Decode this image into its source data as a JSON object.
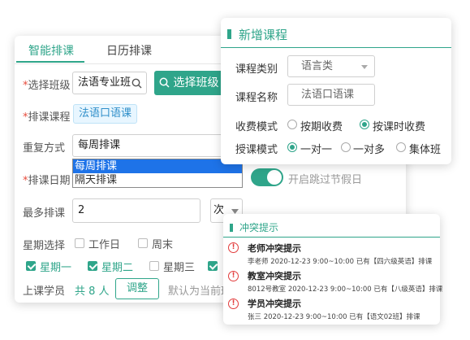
{
  "scheduler": {
    "tabs": [
      "智能排课",
      "日历排课"
    ],
    "class_select": {
      "label": "*选择班级",
      "value": "法语专业班",
      "button": "选择班级"
    },
    "course": {
      "label": "*排课课程",
      "tag": "法语口语课"
    },
    "repeat": {
      "label": "重复方式",
      "value": "每周排课",
      "options": [
        "每周排课",
        "隔天排课"
      ]
    },
    "date": {
      "label": "*排课日期",
      "holiday_toggle": "开启跳过节假日"
    },
    "max": {
      "label": "最多排课",
      "value": "2",
      "unit": "次"
    },
    "weekday": {
      "label": "星期选择",
      "workday": "工作日",
      "weekend": "周末"
    },
    "days": [
      {
        "label": "星期一",
        "checked": true
      },
      {
        "label": "星期二",
        "checked": true
      },
      {
        "label": "星期三",
        "checked": false
      }
    ],
    "students": {
      "label": "上课学员",
      "count": "共 8 人",
      "adjust": "调整",
      "note": "默认为当前班"
    }
  },
  "new_course": {
    "title": "新增课程",
    "category": {
      "label": "课程类别",
      "value": "语言类"
    },
    "name": {
      "label": "课程名称",
      "value": "法语口语课"
    },
    "fee": {
      "label": "收费模式",
      "options": [
        "按期收费",
        "按课时收费"
      ],
      "selected": "按课时收费"
    },
    "mode": {
      "label": "授课模式",
      "options": [
        "一对一",
        "一对多",
        "集体班"
      ],
      "selected": "一对一"
    }
  },
  "conflicts": {
    "title": "冲突提示",
    "items": [
      {
        "title": "老师冲突提示",
        "detail": "李老师  2020-12-23 9:00~10:00 已有【四六级英语】排课"
      },
      {
        "title": "教室冲突提示",
        "detail": "8012号教室  2020-12-23 9:00~10:00 已有【八级英语】排课"
      },
      {
        "title": "学员冲突提示",
        "detail": "张三  2020-12-23 9:00~10:00 已有【语文02班】排课"
      }
    ]
  },
  "colors": {
    "accent": "#2fa58a",
    "warn": "#e23c3c",
    "tag": "#2f8fc9"
  },
  "icons": [
    "search-icon",
    "caret-down-icon",
    "warning-icon"
  ]
}
